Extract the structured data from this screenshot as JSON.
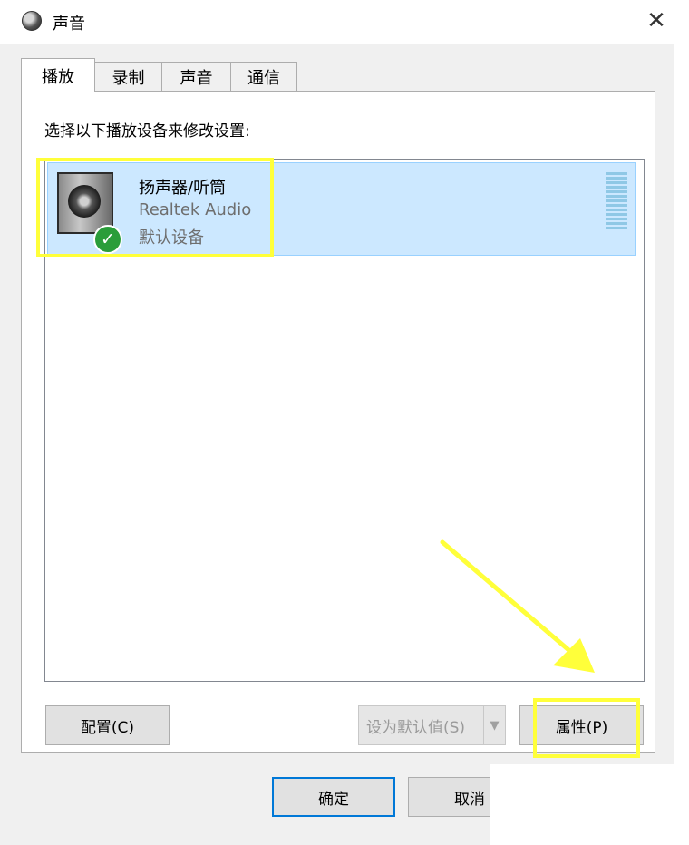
{
  "window": {
    "title": "声音",
    "close_icon": "close-icon"
  },
  "tabs": [
    {
      "label": "播放",
      "active": true
    },
    {
      "label": "录制",
      "active": false
    },
    {
      "label": "声音",
      "active": false
    },
    {
      "label": "通信",
      "active": false
    }
  ],
  "playback": {
    "instruction": "选择以下播放设备来修改设置:",
    "devices": [
      {
        "name": "扬声器/听筒",
        "driver": "Realtek Audio",
        "status": "默认设备",
        "icon": "speaker-icon",
        "badge_icon": "check-icon",
        "selected": true
      }
    ]
  },
  "buttons": {
    "configure": "配置(C)",
    "set_default": "设为默认值(S)",
    "set_default_enabled": false,
    "properties": "属性(P)",
    "ok": "确定",
    "cancel": "取消"
  },
  "colors": {
    "selection": "#cce8ff",
    "highlight": "#ffff3a",
    "badge": "#2a9d3a"
  }
}
